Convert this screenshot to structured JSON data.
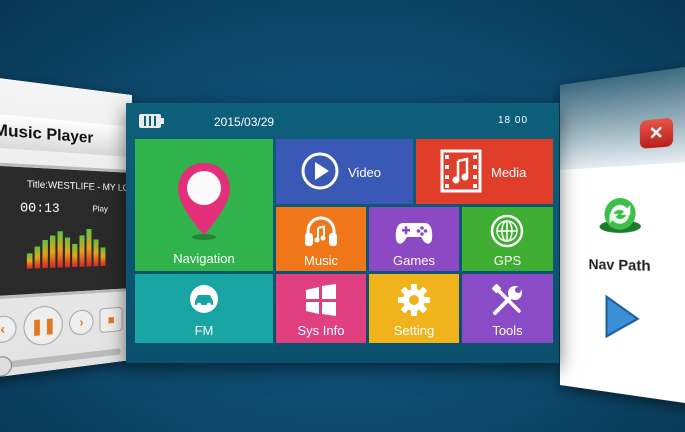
{
  "colors": {
    "navigation": "#2fb34a",
    "video": "#3a58b5",
    "media": "#e03e2a",
    "music": "#f0761a",
    "games": "#8b49c4",
    "gps": "#3fae32",
    "fm": "#1aa5a5",
    "sys_info": "#e0407f",
    "setting": "#f1b31c",
    "tools": "#8a4cc6",
    "background": "#0e4e73"
  },
  "status": {
    "date": "2015/03/29",
    "time": "18  00",
    "battery_icon": "battery-icon"
  },
  "tiles": {
    "navigation": {
      "label": "Navigation",
      "icon": "map-pin-icon"
    },
    "video": {
      "label": "Video",
      "icon": "play-circle-icon"
    },
    "media": {
      "label": "Media",
      "icon": "film-music-icon"
    },
    "music": {
      "label": "Music",
      "icon": "headphones-icon"
    },
    "games": {
      "label": "Games",
      "icon": "gamepad-icon"
    },
    "gps": {
      "label": "GPS",
      "icon": "globe-icon"
    },
    "fm": {
      "label": "FM",
      "icon": "car-radio-icon"
    },
    "sys_info": {
      "label": "Sys Info",
      "icon": "windows-icon"
    },
    "setting": {
      "label": "Setting",
      "icon": "gear-icon"
    },
    "tools": {
      "label": "Tools",
      "icon": "wrench-screwdriver-icon"
    }
  },
  "music_player": {
    "title": "Music Player",
    "track": "Title:WESTLIFE - MY LOVE",
    "time": "00:13",
    "state": "Play"
  },
  "nav_path": {
    "label": "Nav Path",
    "close_icon": "close-icon",
    "nav_icon": "nav-path-icon",
    "play_icon": "play-arrow-icon"
  }
}
